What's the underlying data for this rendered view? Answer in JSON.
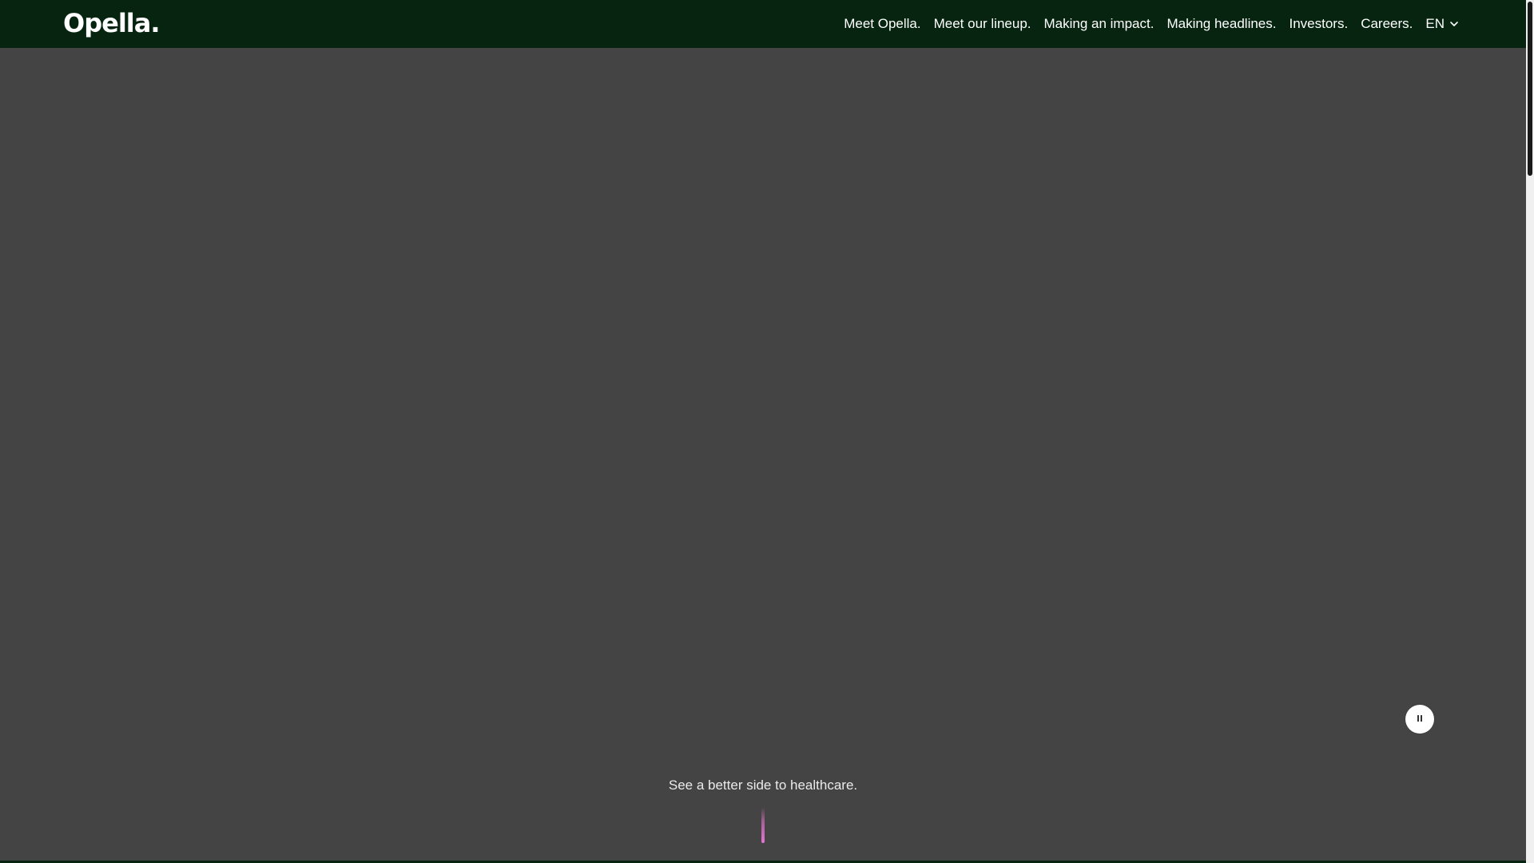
{
  "header": {
    "logo": "Opella.",
    "nav": [
      {
        "label": "Meet Opella."
      },
      {
        "label": "Meet our lineup."
      },
      {
        "label": "Making an impact."
      },
      {
        "label": "Making headlines."
      },
      {
        "label": "Investors."
      },
      {
        "label": "Careers."
      }
    ],
    "language": {
      "selected": "EN",
      "icon": "chevron-down-icon"
    }
  },
  "hero": {
    "tagline": "See a better side to healthcare.",
    "video_control_icon": "pause-icon",
    "scroll_cue_icon": "scroll-indicator"
  },
  "colors": {
    "header_bg": "#06240f",
    "hero_bg": "#444444",
    "accent": "#e874d4",
    "text": "#ffffff"
  }
}
